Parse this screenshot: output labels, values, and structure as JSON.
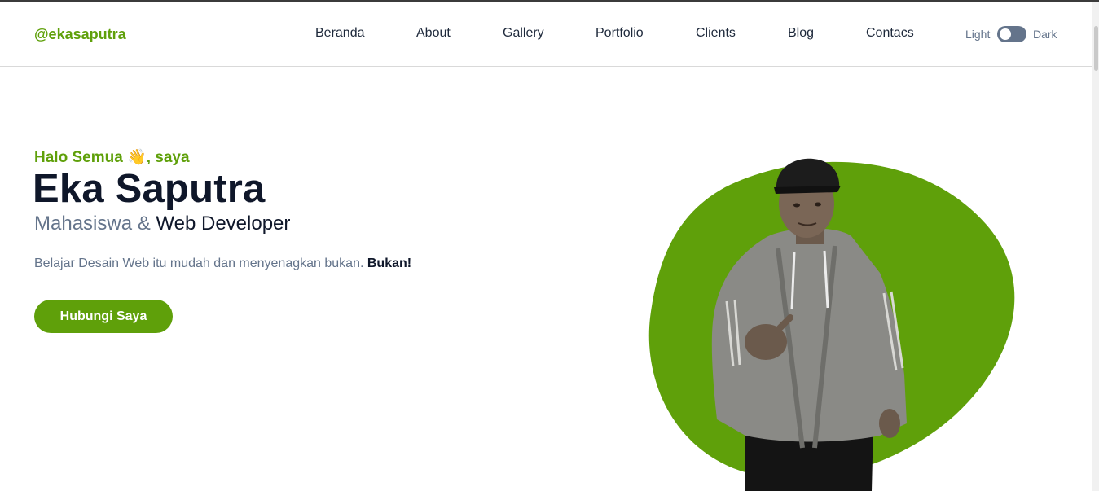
{
  "header": {
    "logo": "@ekasaputra",
    "nav": [
      "Beranda",
      "About",
      "Gallery",
      "Portfolio",
      "Clients",
      "Blog",
      "Contacs"
    ],
    "toggle": {
      "light_label": "Light",
      "dark_label": "Dark"
    }
  },
  "hero": {
    "greeting": "Halo Semua 👋, saya",
    "name": "Eka Saputra",
    "role_prefix": "Mahasiswa &",
    "role_main": "Web Developer",
    "description": "Belajar Desain Web itu mudah dan menyenagkan bukan.",
    "description_bold": "Bukan!",
    "cta_label": "Hubungi Saya"
  },
  "colors": {
    "accent": "#5fa00a",
    "heading": "#0f172a",
    "muted": "#64748b"
  }
}
